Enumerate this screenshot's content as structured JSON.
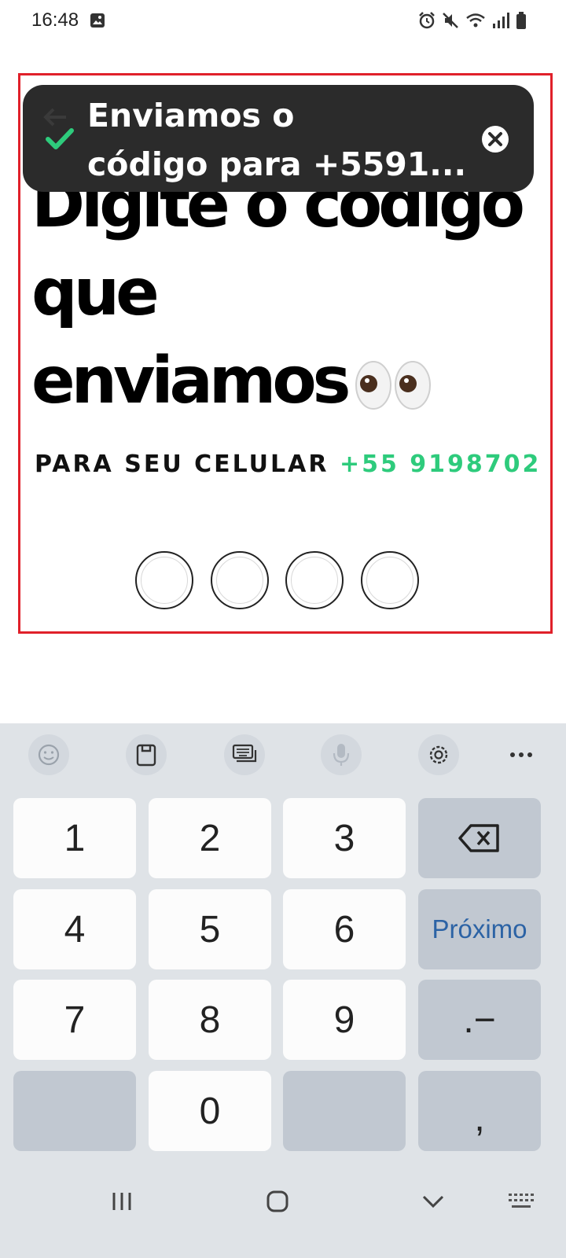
{
  "status_bar": {
    "time": "16:48",
    "icons": [
      "image-icon",
      "alarm-icon",
      "mute-icon",
      "wifi-icon",
      "signal-icon",
      "battery-icon"
    ]
  },
  "heading": {
    "line1": "Digite o código",
    "line2": "que",
    "line3": "enviamos",
    "emoji": "eyes-icon"
  },
  "subtitle": {
    "label": "PARA SEU CELULAR",
    "phone": "+55 9198702"
  },
  "code_inputs": [
    "",
    "",
    "",
    ""
  ],
  "toast": {
    "line1": "Enviamos o",
    "line2": "código para +5591...",
    "status_icon": "check-icon",
    "close_icon": "close-icon"
  },
  "keyboard": {
    "toolbar": [
      "emoji-icon",
      "clipboard-icon",
      "keyboard-mode-icon",
      "microphone-icon",
      "settings-icon",
      "more-icon"
    ],
    "keys": {
      "k1": "1",
      "k2": "2",
      "k3": "3",
      "k4": "4",
      "k5": "5",
      "k6": "6",
      "k7": "7",
      "k8": "8",
      "k9": "9",
      "k0": "0",
      "next": "Próximo",
      "dot_dash": ".−",
      "comma": ","
    }
  },
  "nav_bar": [
    "recents-icon",
    "home-icon",
    "hide-keyboard-icon",
    "keyboard-switch-icon"
  ],
  "colors": {
    "accent_green": "#2ecb7c",
    "toast_bg": "#2b2b2b",
    "highlight_border": "#e0202a",
    "next_key_text": "#2c63a5"
  }
}
